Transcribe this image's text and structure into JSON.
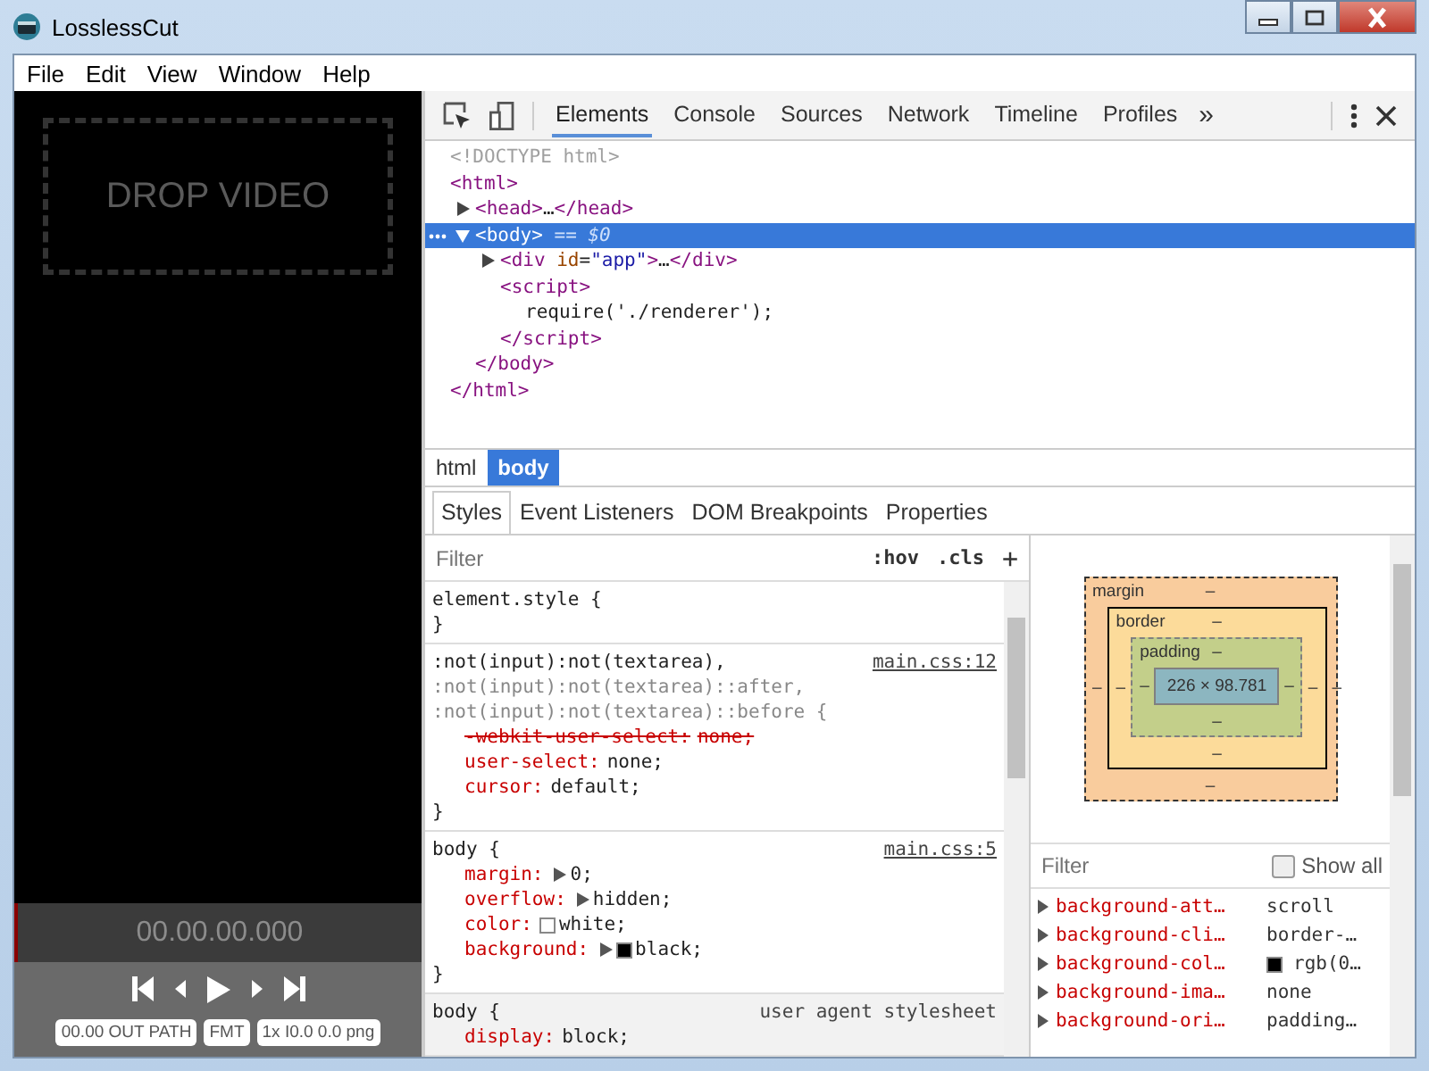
{
  "window": {
    "title": "LosslessCut"
  },
  "menu": [
    "File",
    "Edit",
    "View",
    "Window",
    "Help"
  ],
  "player": {
    "drop_label": "DROP VIDEO",
    "timecode": "00.00.00.000",
    "buttons": [
      "00.00 OUT PATH",
      "FMT",
      "1x I0.0 0.0 png"
    ]
  },
  "devtools": {
    "tabs": [
      {
        "label": "Elements",
        "selected": true
      },
      {
        "label": "Console",
        "selected": false
      },
      {
        "label": "Sources",
        "selected": false
      },
      {
        "label": "Network",
        "selected": false
      },
      {
        "label": "Timeline",
        "selected": false
      },
      {
        "label": "Profiles",
        "selected": false
      }
    ],
    "more_tabs": "»",
    "dom": [
      {
        "selected": false,
        "parts": [
          {
            "kind": "doctype",
            "text": "<!DOCTYPE html>"
          }
        ]
      },
      {
        "selected": false,
        "parts": [
          {
            "kind": "tag",
            "text": "<html>"
          }
        ],
        "close": [
          {
            "kind": "tag",
            "text": "</html>"
          }
        ],
        "children": [
          {
            "selected": false,
            "expanded": false,
            "parts": [
              {
                "kind": "tag",
                "text": "<head>"
              },
              {
                "kind": "text",
                "text": "…"
              },
              {
                "kind": "tag",
                "text": "</head>"
              }
            ]
          },
          {
            "selected": true,
            "expanded": true,
            "parts": [
              {
                "kind": "tag",
                "text": "<body>"
              },
              {
                "kind": "marker",
                "text": " == $0"
              }
            ],
            "close": [
              {
                "kind": "tag",
                "text": "</body>"
              }
            ],
            "children": [
              {
                "selected": false,
                "expanded": false,
                "parts": [
                  {
                    "kind": "tag",
                    "text": "<div "
                  },
                  {
                    "kind": "attr",
                    "text": "id"
                  },
                  {
                    "kind": "text",
                    "text": "="
                  },
                  {
                    "kind": "value",
                    "text": "\"app\""
                  },
                  {
                    "kind": "tag",
                    "text": ">"
                  },
                  {
                    "kind": "text",
                    "text": "…"
                  },
                  {
                    "kind": "tag",
                    "text": "</div>"
                  }
                ]
              },
              {
                "selected": false,
                "parts": [
                  {
                    "kind": "tag",
                    "text": "<script>"
                  }
                ],
                "close": [
                  {
                    "kind": "tag",
                    "text": "</script>"
                  }
                ],
                "children": [
                  {
                    "selected": false,
                    "parts": [
                      {
                        "kind": "text",
                        "text": "require('./renderer');"
                      }
                    ]
                  }
                ]
              }
            ]
          }
        ]
      }
    ],
    "breadcrumbs": [
      {
        "label": "html",
        "selected": false
      },
      {
        "label": "body",
        "selected": true
      }
    ],
    "panel_tabs": [
      {
        "label": "Styles",
        "selected": true
      },
      {
        "label": "Event Listeners",
        "selected": false
      },
      {
        "label": "DOM Breakpoints",
        "selected": false
      },
      {
        "label": "Properties",
        "selected": false
      }
    ],
    "styles": {
      "filter": {
        "placeholder": "Filter"
      },
      "hov": ":hov",
      "cls": ".cls",
      "add": "+",
      "rules": [
        {
          "kind": "inline",
          "selectors": [
            {
              "text": "element.style {",
              "matched": true
            }
          ],
          "close": "}"
        },
        {
          "kind": "author",
          "source": "main.css:12",
          "selectors": [
            {
              "text": ":not(input):not(textarea),",
              "matched": true
            },
            {
              "text": ":not(input):not(textarea)::after,",
              "matched": false
            },
            {
              "text": ":not(input):not(textarea)::before {",
              "matched": false
            }
          ],
          "props": [
            {
              "name": "-webkit-user-select:",
              "value": "none;",
              "overridden": true,
              "expandable": false
            },
            {
              "name": "user-select:",
              "value": "none;",
              "overridden": false,
              "expandable": false
            },
            {
              "name": "cursor:",
              "value": "default;",
              "overridden": false,
              "expandable": false
            }
          ],
          "close": "}"
        },
        {
          "kind": "author",
          "source": "main.css:5",
          "selectors": [
            {
              "text": "body {",
              "matched": true
            }
          ],
          "props": [
            {
              "name": "margin:",
              "value": "0;",
              "overridden": false,
              "expandable": true
            },
            {
              "name": "overflow:",
              "value": "hidden;",
              "overridden": false,
              "expandable": true
            },
            {
              "name": "color:",
              "value": "white;",
              "overridden": false,
              "expandable": false,
              "color": "#ffffff"
            },
            {
              "name": "background:",
              "value": "black;",
              "overridden": false,
              "expandable": true,
              "color": "#000000"
            }
          ],
          "close": "}"
        },
        {
          "kind": "user_agent",
          "source": "user agent stylesheet",
          "selectors": [
            {
              "text": "body {",
              "matched": true
            }
          ],
          "props": [
            {
              "name": "display:",
              "value": "block;",
              "overridden": false,
              "expandable": false
            }
          ]
        }
      ]
    },
    "box_model": {
      "margin": {
        "label": "margin",
        "top": "–",
        "right": "–",
        "bottom": "–",
        "left": "–"
      },
      "border": {
        "label": "border",
        "top": "–",
        "right": "–",
        "bottom": "–",
        "left": "–"
      },
      "padding": {
        "label": "padding",
        "top": "–",
        "right": "–",
        "bottom": "–",
        "left": "–"
      },
      "content": "226 × 98.781"
    },
    "computed": {
      "filter": {
        "placeholder": "Filter"
      },
      "show_all": {
        "label": "Show all",
        "checked": false
      },
      "props": [
        {
          "name": "background-att…",
          "value": "scroll"
        },
        {
          "name": "background-cli…",
          "value": "border-…"
        },
        {
          "name": "background-col…",
          "value": "rgb(0…",
          "color": "#000000"
        },
        {
          "name": "background-ima…",
          "value": "none"
        },
        {
          "name": "background-ori…",
          "value": "padding…"
        }
      ]
    }
  }
}
